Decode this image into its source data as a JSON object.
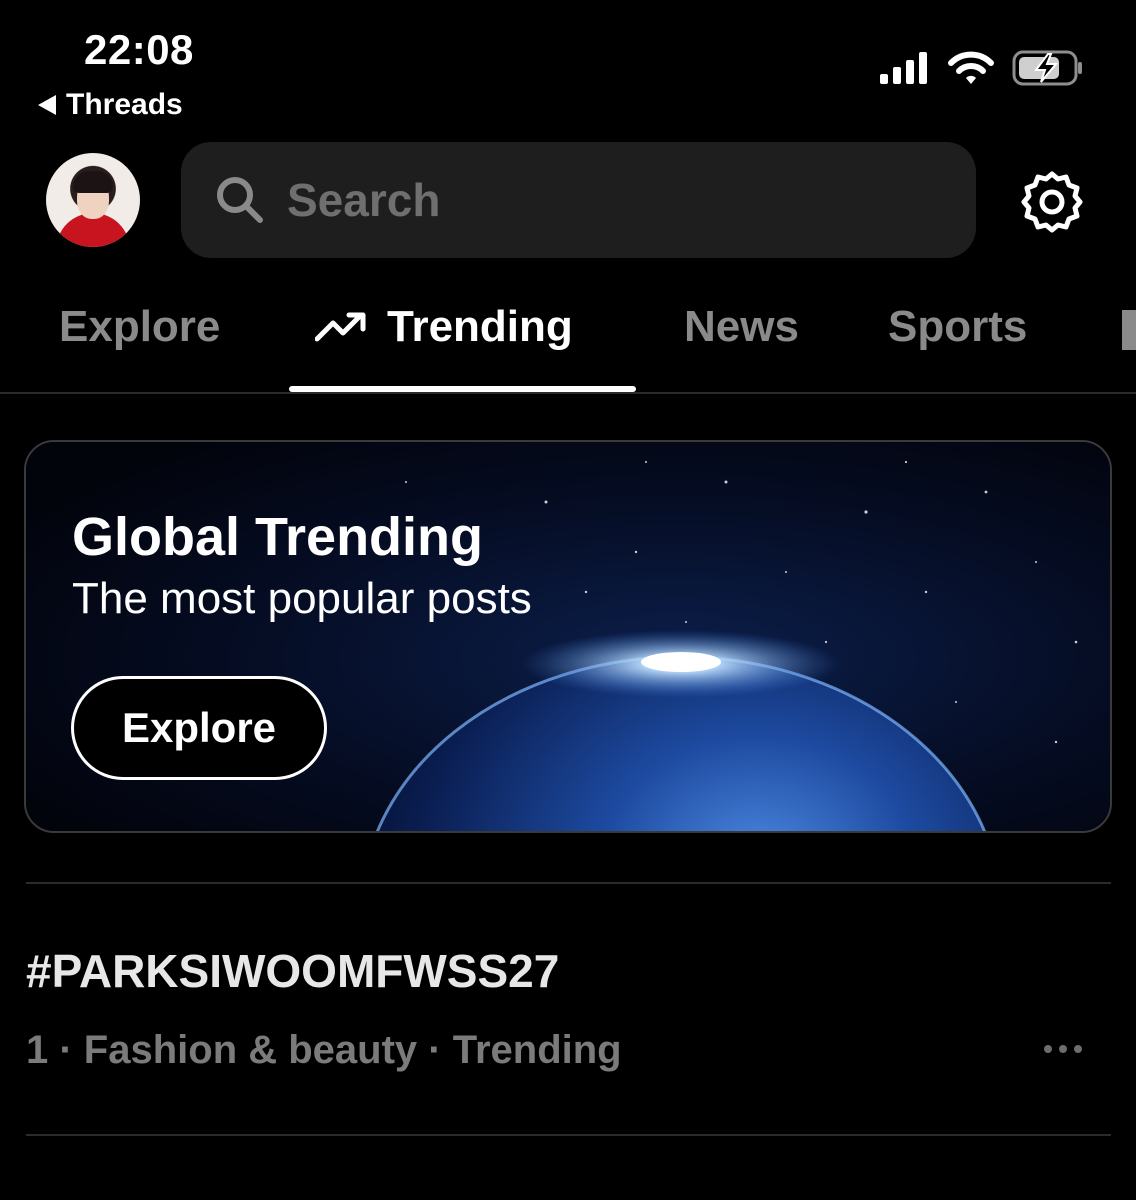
{
  "status_bar": {
    "time": "22:08",
    "back_label": "Threads"
  },
  "header": {
    "search_placeholder": "Search"
  },
  "tabs": [
    {
      "label": "Explore",
      "active": false
    },
    {
      "label": "Trending",
      "active": true
    },
    {
      "label": "News",
      "active": false
    },
    {
      "label": "Sports",
      "active": false
    }
  ],
  "banner": {
    "title": "Global Trending",
    "subtitle": "The most popular posts",
    "button_label": "Explore"
  },
  "trends": [
    {
      "title": "#PARKSIWOOMFWSS27",
      "meta": "1 · Fashion & beauty · Trending"
    }
  ],
  "icons": {
    "signal": "signal-icon",
    "wifi": "wifi-icon",
    "battery": "battery-charging-icon",
    "search": "search-icon",
    "settings": "gear-icon",
    "trending": "trending-arrow-icon",
    "more": "more-horizontal-icon"
  },
  "colors": {
    "background": "#000000",
    "search_bg": "#1e1e1e",
    "muted_text": "#7b7b7b",
    "divider": "#2b2b2b"
  }
}
